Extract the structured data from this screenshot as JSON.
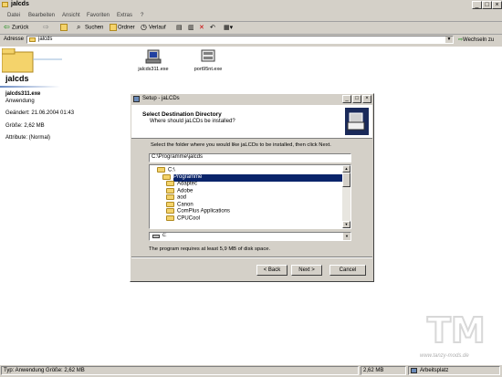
{
  "window": {
    "title": "jalcds",
    "controls": [
      "_",
      "□",
      "×"
    ]
  },
  "menubar": [
    "Datei",
    "Bearbeiten",
    "Ansicht",
    "Favoriten",
    "Extras",
    "?"
  ],
  "toolbar": {
    "back": "Zurück",
    "search": "Suchen",
    "folders": "Ordner",
    "history": "Verlauf"
  },
  "address": {
    "label": "Adresse",
    "value": "jalcds",
    "go": "Wechseln zu"
  },
  "folder_title": "jalcds",
  "details": {
    "filename": "jalcds311.exe",
    "type": "Anwendung",
    "modified": "Geändert: 21.06.2004 01:43",
    "size": "Größe: 2,62 MB",
    "attributes": "Attribute: (Normal)"
  },
  "files": [
    {
      "name": "jalcds311.exe",
      "icon": "setup-icon"
    },
    {
      "name": "port95nt.exe",
      "icon": "setup-icon"
    }
  ],
  "dialog": {
    "title": "Setup - jaLCDs",
    "header_title": "Select Destination Directory",
    "header_subtitle": "Where should jaLCDs be installed?",
    "instruction": "Select the folder where you would like jaLCDs to be installed, then click Next.",
    "path": "C:\\Programme\\jalcds",
    "tree": [
      "C:\\",
      "Programme",
      "Adaptec",
      "Adobe",
      "aod",
      "Canon",
      "ComPlus Applications",
      "CPUCool"
    ],
    "selected_index": 1,
    "drive": "c:",
    "space_note": "The program requires at least 5,9 MB of disk space.",
    "back_btn": "< Back",
    "next_btn": "Next >",
    "cancel_btn": "Cancel"
  },
  "status": {
    "left": "Typ: Anwendung Größe: 2,62 MB",
    "size": "2,62 MB",
    "zone": "Arbeitsplatz"
  },
  "watermark": "www.tanzy-mods.de"
}
